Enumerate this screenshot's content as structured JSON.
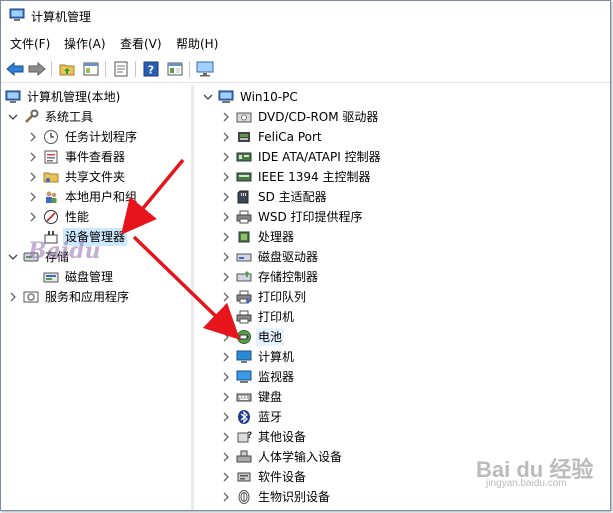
{
  "window": {
    "title": "计算机管理"
  },
  "menu": [
    "文件(F)",
    "操作(A)",
    "查看(V)",
    "帮助(H)"
  ],
  "toolbar": [
    "back-icon",
    "forward-icon",
    "up-folder-icon",
    "show-tree-icon",
    "properties-icon",
    "help-icon",
    "console-icon",
    "monitor-icon"
  ],
  "left_tree": [
    {
      "label": "计算机管理(本地)",
      "icon": "computer-manage-icon",
      "toggle": "",
      "level": 0
    },
    {
      "label": "系统工具",
      "icon": "tools-icon",
      "toggle": "expanded",
      "level": 1
    },
    {
      "label": "任务计划程序",
      "icon": "clock-icon",
      "toggle": "collapsed",
      "level": 2
    },
    {
      "label": "事件查看器",
      "icon": "event-viewer-icon",
      "toggle": "collapsed",
      "level": 2
    },
    {
      "label": "共享文件夹",
      "icon": "shared-folder-icon",
      "toggle": "collapsed",
      "level": 2
    },
    {
      "label": "本地用户和组",
      "icon": "users-icon",
      "toggle": "collapsed",
      "level": 2
    },
    {
      "label": "性能",
      "icon": "performance-icon",
      "toggle": "collapsed",
      "level": 2
    },
    {
      "label": "设备管理器",
      "icon": "device-manager-icon",
      "toggle": "",
      "level": 2,
      "selected": true
    },
    {
      "label": "存储",
      "icon": "storage-icon",
      "toggle": "expanded",
      "level": 1
    },
    {
      "label": "磁盘管理",
      "icon": "disk-icon",
      "toggle": "",
      "level": 2
    },
    {
      "label": "服务和应用程序",
      "icon": "services-icon",
      "toggle": "collapsed",
      "level": 1
    }
  ],
  "device_tree": {
    "root": "Win10-PC",
    "items": [
      {
        "label": "DVD/CD-ROM 驱动器",
        "icon": "dvd-drive-icon"
      },
      {
        "label": "FeliCa Port",
        "icon": "felica-icon"
      },
      {
        "label": "IDE ATA/ATAPI 控制器",
        "icon": "ide-controller-icon"
      },
      {
        "label": "IEEE 1394 主控制器",
        "icon": "ieee1394-icon"
      },
      {
        "label": "SD 主适配器",
        "icon": "sd-adapter-icon"
      },
      {
        "label": "WSD 打印提供程序",
        "icon": "printer-icon"
      },
      {
        "label": "处理器",
        "icon": "cpu-icon"
      },
      {
        "label": "磁盘驱动器",
        "icon": "disk-drive-icon"
      },
      {
        "label": "存储控制器",
        "icon": "storage-controller-icon"
      },
      {
        "label": "打印队列",
        "icon": "print-queue-icon"
      },
      {
        "label": "打印机",
        "icon": "printer-icon"
      },
      {
        "label": "电池",
        "icon": "battery-icon",
        "selected": true
      },
      {
        "label": "计算机",
        "icon": "computer-icon"
      },
      {
        "label": "监视器",
        "icon": "monitor-icon"
      },
      {
        "label": "键盘",
        "icon": "keyboard-icon"
      },
      {
        "label": "蓝牙",
        "icon": "bluetooth-icon"
      },
      {
        "label": "其他设备",
        "icon": "other-device-icon"
      },
      {
        "label": "人体学输入设备",
        "icon": "hid-icon"
      },
      {
        "label": "软件设备",
        "icon": "software-device-icon"
      },
      {
        "label": "生物识别设备",
        "icon": "biometric-icon"
      }
    ]
  },
  "overlay": {
    "arrow_color": "#e8141c",
    "watermark_left": "Baidu",
    "watermark": "Bai du 经验",
    "watermark_sub": "jingyan.baidu.com"
  }
}
